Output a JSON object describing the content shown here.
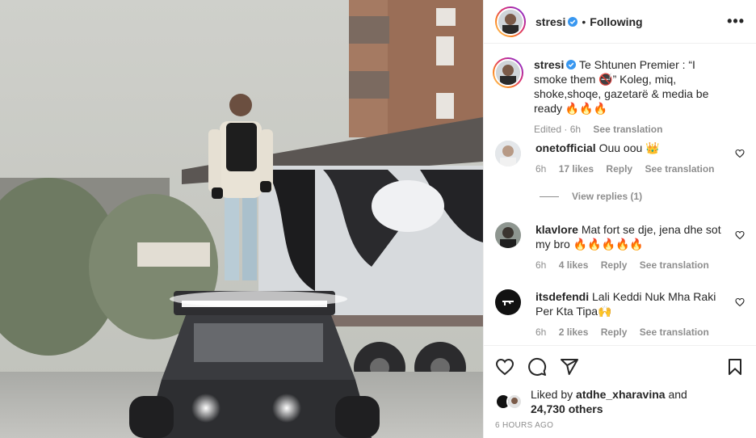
{
  "header": {
    "username": "stresi",
    "separator": "•",
    "follow_label": "Following",
    "more_label": "•••"
  },
  "caption": {
    "username": "stresi",
    "text": "Te Shtunen Premier : “I smoke them 🚭” Koleg, miq, shoke,shoqe, gazetarë & media be ready 🔥🔥🔥",
    "time": "Edited · 6h",
    "see_translation": "See translation"
  },
  "comments": [
    {
      "username": "onetofficial",
      "text": "Ouu oou 👑",
      "time": "6h",
      "likes": "17 likes",
      "reply": "Reply",
      "see_translation": "See translation"
    },
    {
      "username": "klavlore",
      "text": "Mat fort se dje, jena dhe sot my bro 🔥🔥🔥🔥🔥",
      "time": "6h",
      "likes": "4 likes",
      "reply": "Reply",
      "see_translation": "See translation"
    },
    {
      "username": "itsdefendi",
      "text": "Lali Keddi Nuk Mha Raki Per Kta Tipa🙌",
      "time": "6h",
      "likes": "2 likes",
      "reply": "Reply",
      "see_translation": "See translation"
    }
  ],
  "view_replies": "View replies (1)",
  "likes_summary": {
    "prefix": "Liked by",
    "user": "atdhe_xharavina",
    "suffix": "and",
    "others": "24,730 others"
  },
  "date_label": "6 HOURS AGO",
  "icons": {
    "heart": "heart-icon",
    "comment": "comment-icon",
    "share": "share-icon",
    "save": "bookmark-icon",
    "verified": "verified-badge-icon",
    "more": "more-options-icon"
  },
  "colors": {
    "verified_blue": "#3897f0",
    "text": "#262626",
    "muted": "#8e8e8e"
  }
}
